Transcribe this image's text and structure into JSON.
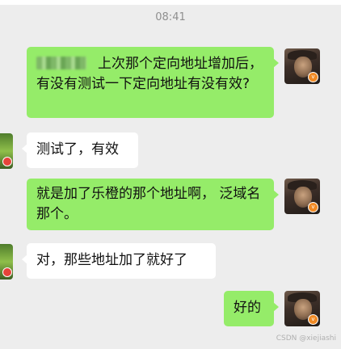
{
  "status_bar": {
    "time": "08:41"
  },
  "messages": [
    {
      "side": "out",
      "redacted": true,
      "text": "上次那个定向地址增加后，有没有测试一下定向地址有没有效?"
    },
    {
      "side": "in",
      "text": "测试了，有效"
    },
    {
      "side": "out",
      "text": "就是加了乐橙的那个地址啊， 泛域名那个。"
    },
    {
      "side": "in",
      "text": "对，那些地址加了就好了"
    },
    {
      "side": "out",
      "text": "好的"
    }
  ],
  "watermark": "CSDN @xiejiashi",
  "colors": {
    "out_bubble": "#95ec69",
    "in_bubble": "#ffffff",
    "background": "#ededed"
  },
  "icons": {
    "avatar_badge": "v-badge"
  }
}
